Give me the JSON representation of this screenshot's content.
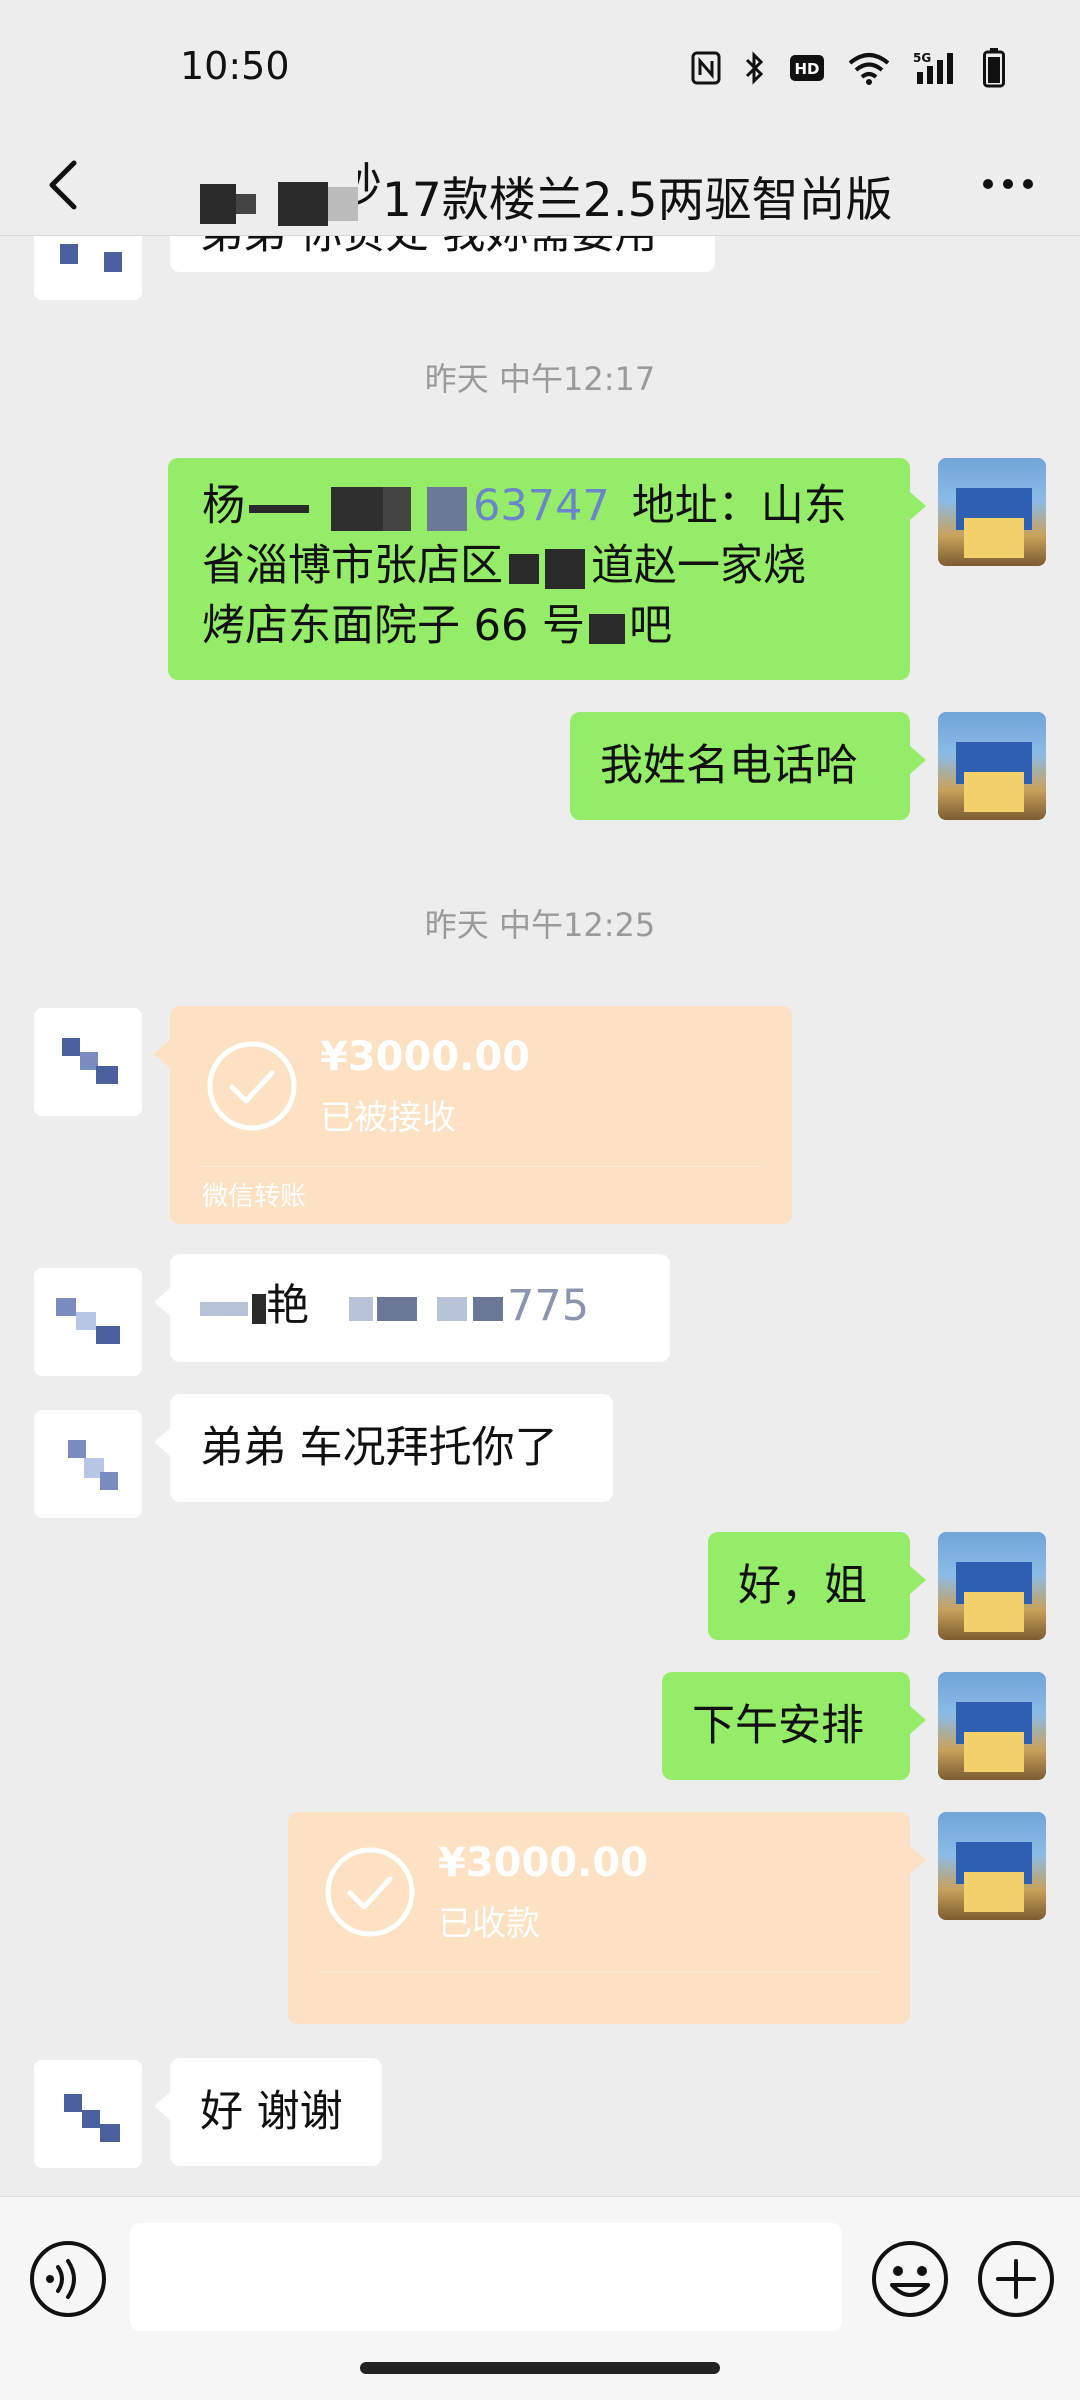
{
  "status_bar": {
    "time": "10:50",
    "icons": [
      "nfc-icon",
      "bluetooth-icon",
      "hd-icon",
      "wifi-icon",
      "5g-signal-icon",
      "battery-icon"
    ],
    "hd_label": "HD",
    "network_label": "5G"
  },
  "header": {
    "title_visible": "17款楼兰2.5两驱智尚版",
    "title_partial_char": "秒"
  },
  "messages": {
    "partial_top_text": "弟弟 你负处 我妳需要用",
    "ts1": "昨天 中午12:17",
    "m1_line1_prefix": "杨",
    "m1_line1_digits": "63747",
    "m1_line1_suffix": "地址：山东",
    "m1_line2_a": "省淄博市张店区",
    "m1_line2_b": "道赵一家烧",
    "m1_line3_a": "烤店东面院子 66 号",
    "m1_line3_b": "吧",
    "m2": "我姓名电话哈",
    "ts2": "昨天 中午12:25",
    "transfer1": {
      "amount": "¥3000.00",
      "status": "已被接收",
      "footer": "微信转账"
    },
    "m4_text": "艳",
    "m4_digits": "775",
    "m5": "弟弟 车况拜托你了",
    "m6": "好，姐",
    "m7": "下午安排",
    "transfer2": {
      "amount": "¥3000.00",
      "status": "已收款"
    },
    "m8": "好 谢谢"
  },
  "input": {
    "placeholder": ""
  },
  "colors": {
    "chat_bg": "#ededed",
    "outgoing_bubble": "#95ec69",
    "incoming_bubble": "#ffffff",
    "transfer_card": "#fce1c3"
  }
}
